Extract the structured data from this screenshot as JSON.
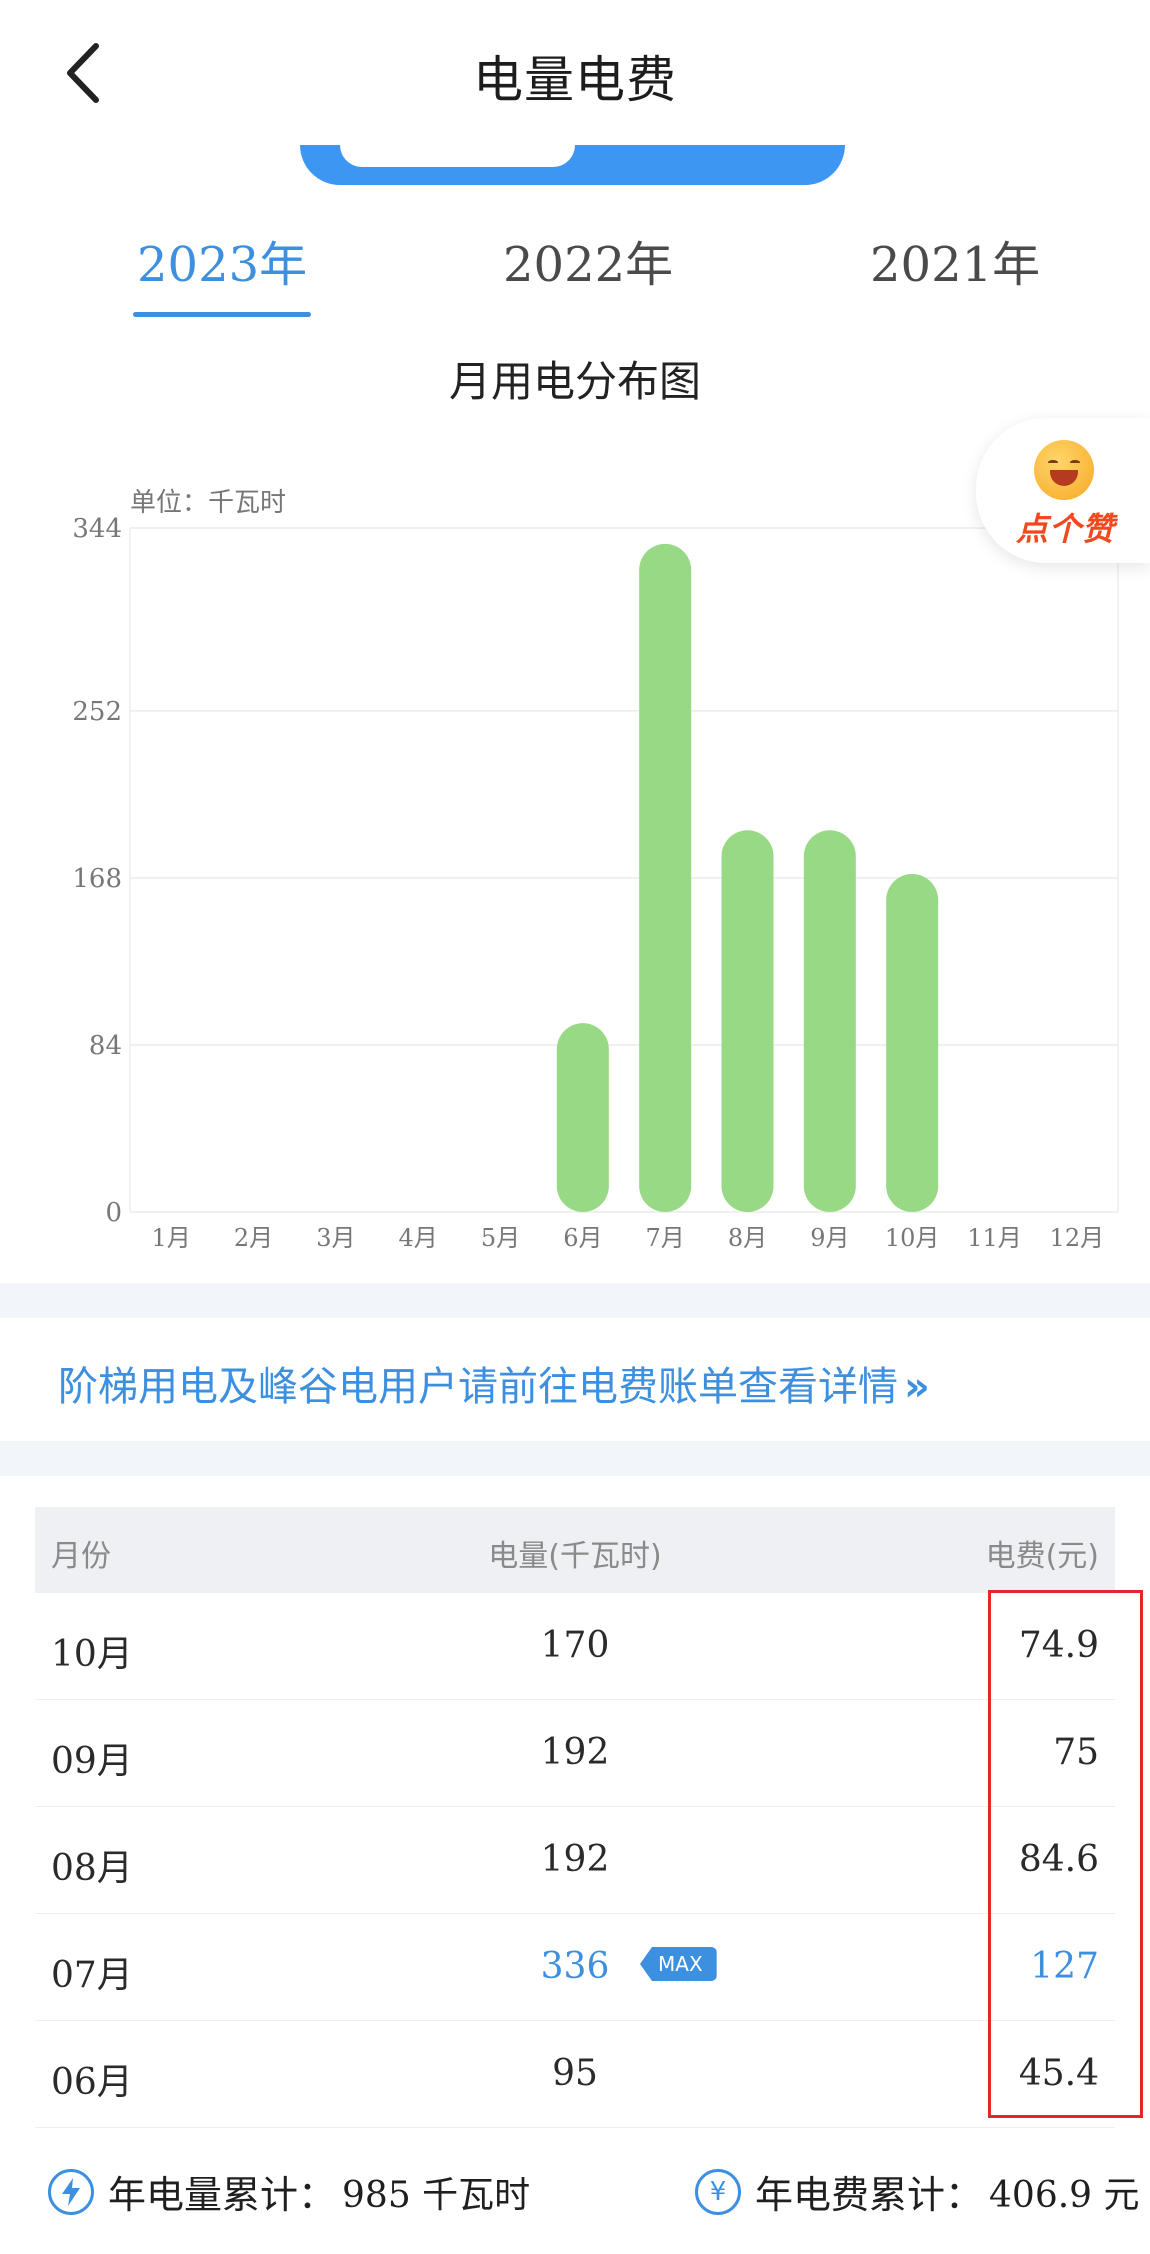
{
  "header": {
    "title": "电量电费",
    "back_icon": "chevron-left-icon"
  },
  "years": {
    "tabs": [
      "2023年",
      "2022年",
      "2021年"
    ],
    "active": 0
  },
  "chart_title": "月用电分布图",
  "like": {
    "text": "点个赞"
  },
  "chart_data": {
    "type": "bar",
    "unit_label": "单位：千瓦时",
    "categories": [
      "1月",
      "2月",
      "3月",
      "4月",
      "5月",
      "6月",
      "7月",
      "8月",
      "9月",
      "10月",
      "11月",
      "12月"
    ],
    "values": [
      0,
      0,
      0,
      0,
      0,
      95,
      336,
      192,
      192,
      170,
      0,
      0
    ],
    "yticks": [
      0,
      84,
      168,
      252,
      344
    ],
    "ylim": [
      0,
      344
    ],
    "bar_color": "#98d985",
    "grid": true
  },
  "notice": {
    "text": "阶梯用电及峰谷电用户请前往电费账单查看详情",
    "arrow": "»"
  },
  "table": {
    "headers": {
      "month": "月份",
      "kwh": "电量(千瓦时)",
      "fee": "电费(元)"
    },
    "rows": [
      {
        "month": "10月",
        "kwh": "170",
        "fee": "74.9",
        "max": false
      },
      {
        "month": "09月",
        "kwh": "192",
        "fee": "75",
        "max": false
      },
      {
        "month": "08月",
        "kwh": "192",
        "fee": "84.6",
        "max": false
      },
      {
        "month": "07月",
        "kwh": "336",
        "fee": "127",
        "max": true
      },
      {
        "month": "06月",
        "kwh": "95",
        "fee": "45.4",
        "max": false
      }
    ],
    "max_badge": "MAX"
  },
  "summary": {
    "kwh_label": "年电量累计：",
    "kwh_value": "985 千瓦时",
    "fee_label": "年电费累计：",
    "fee_value": "406.9 元",
    "kwh_icon": "lightning-icon",
    "fee_icon": "yen-icon"
  },
  "colors": {
    "accent": "#3d8fe0",
    "bar": "#98d985",
    "annotation": "#e2282d"
  }
}
